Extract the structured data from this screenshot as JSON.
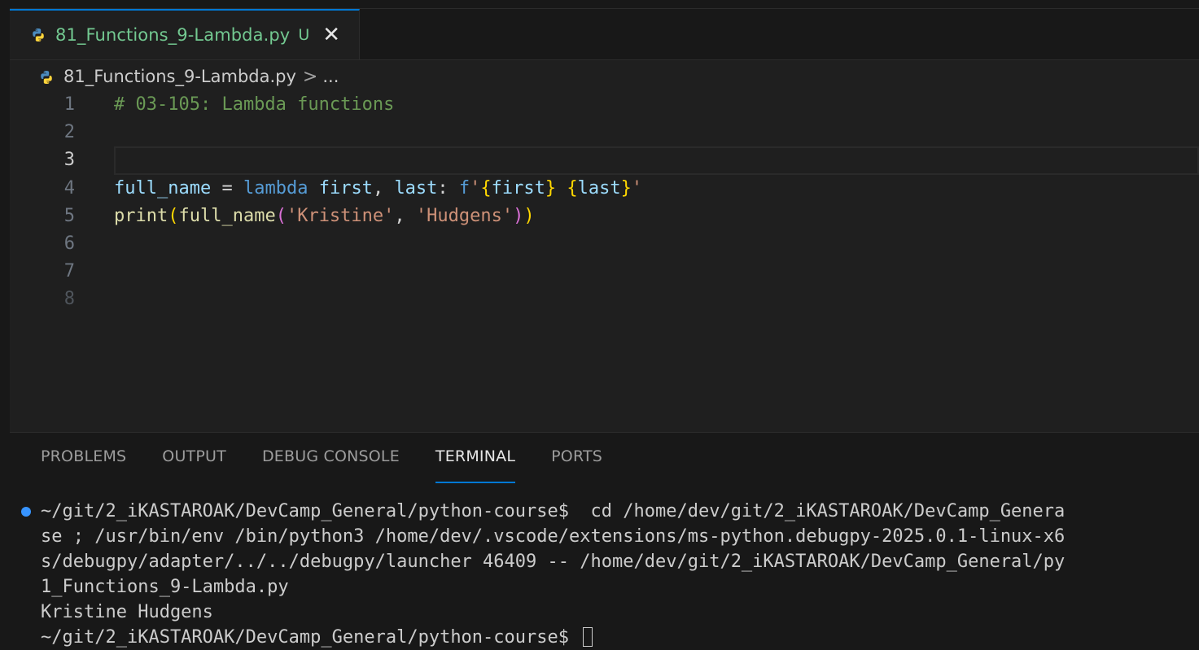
{
  "tab": {
    "filename": "81_Functions_9-Lambda.py",
    "status": "U",
    "close_glyph": "✕",
    "label_color": "#73c991",
    "accent": "#0078d4"
  },
  "breadcrumb": {
    "file": "81_Functions_9-Lambda.py",
    "separator": ">",
    "rest": "..."
  },
  "editor": {
    "active_line": 3,
    "lines": [
      {
        "num": "1",
        "tokens": [
          {
            "t": "# 03-105: Lambda functions",
            "c": "comment"
          }
        ]
      },
      {
        "num": "2",
        "tokens": []
      },
      {
        "num": "3",
        "tokens": []
      },
      {
        "num": "4",
        "tokens": [
          {
            "t": "full_name",
            "c": "var"
          },
          {
            "t": " = ",
            "c": "op"
          },
          {
            "t": "lambda",
            "c": "kw"
          },
          {
            "t": " ",
            "c": "op"
          },
          {
            "t": "first",
            "c": "var"
          },
          {
            "t": ", ",
            "c": "op"
          },
          {
            "t": "last",
            "c": "var"
          },
          {
            "t": ": ",
            "c": "op"
          },
          {
            "t": "f",
            "c": "kw"
          },
          {
            "t": "'",
            "c": "str"
          },
          {
            "t": "{",
            "c": "brace"
          },
          {
            "t": "first",
            "c": "var"
          },
          {
            "t": "}",
            "c": "brace"
          },
          {
            "t": " ",
            "c": "str"
          },
          {
            "t": "{",
            "c": "brace"
          },
          {
            "t": "last",
            "c": "var"
          },
          {
            "t": "}",
            "c": "brace"
          },
          {
            "t": "'",
            "c": "str"
          }
        ]
      },
      {
        "num": "5",
        "tokens": [
          {
            "t": "print",
            "c": "fn"
          },
          {
            "t": "(",
            "c": "brace"
          },
          {
            "t": "full_name",
            "c": "fn"
          },
          {
            "t": "(",
            "c": "paren"
          },
          {
            "t": "'Kristine'",
            "c": "str"
          },
          {
            "t": ", ",
            "c": "op"
          },
          {
            "t": "'Hudgens'",
            "c": "str"
          },
          {
            "t": ")",
            "c": "paren"
          },
          {
            "t": ")",
            "c": "brace"
          }
        ]
      },
      {
        "num": "6",
        "tokens": []
      },
      {
        "num": "7",
        "tokens": []
      },
      {
        "num": "8",
        "tokens": [],
        "dim": true
      }
    ]
  },
  "panel": {
    "tabs": [
      "PROBLEMS",
      "OUTPUT",
      "DEBUG CONSOLE",
      "TERMINAL",
      "PORTS"
    ],
    "active_tab": "TERMINAL"
  },
  "terminal": {
    "lines": [
      "~/git/2_iKASTAROAK/DevCamp_General/python-course$  cd /home/dev/git/2_iKASTAROAK/DevCamp_Genera",
      "se ; /usr/bin/env /bin/python3 /home/dev/.vscode/extensions/ms-python.debugpy-2025.0.1-linux-x6",
      "s/debugpy/adapter/../../debugpy/launcher 46409 -- /home/dev/git/2_iKASTAROAK/DevCamp_General/py",
      "1_Functions_9-Lambda.py",
      "Kristine Hudgens",
      "~/git/2_iKASTAROAK/DevCamp_General/python-course$ "
    ],
    "prompt_dot_color": "#3794ff"
  }
}
